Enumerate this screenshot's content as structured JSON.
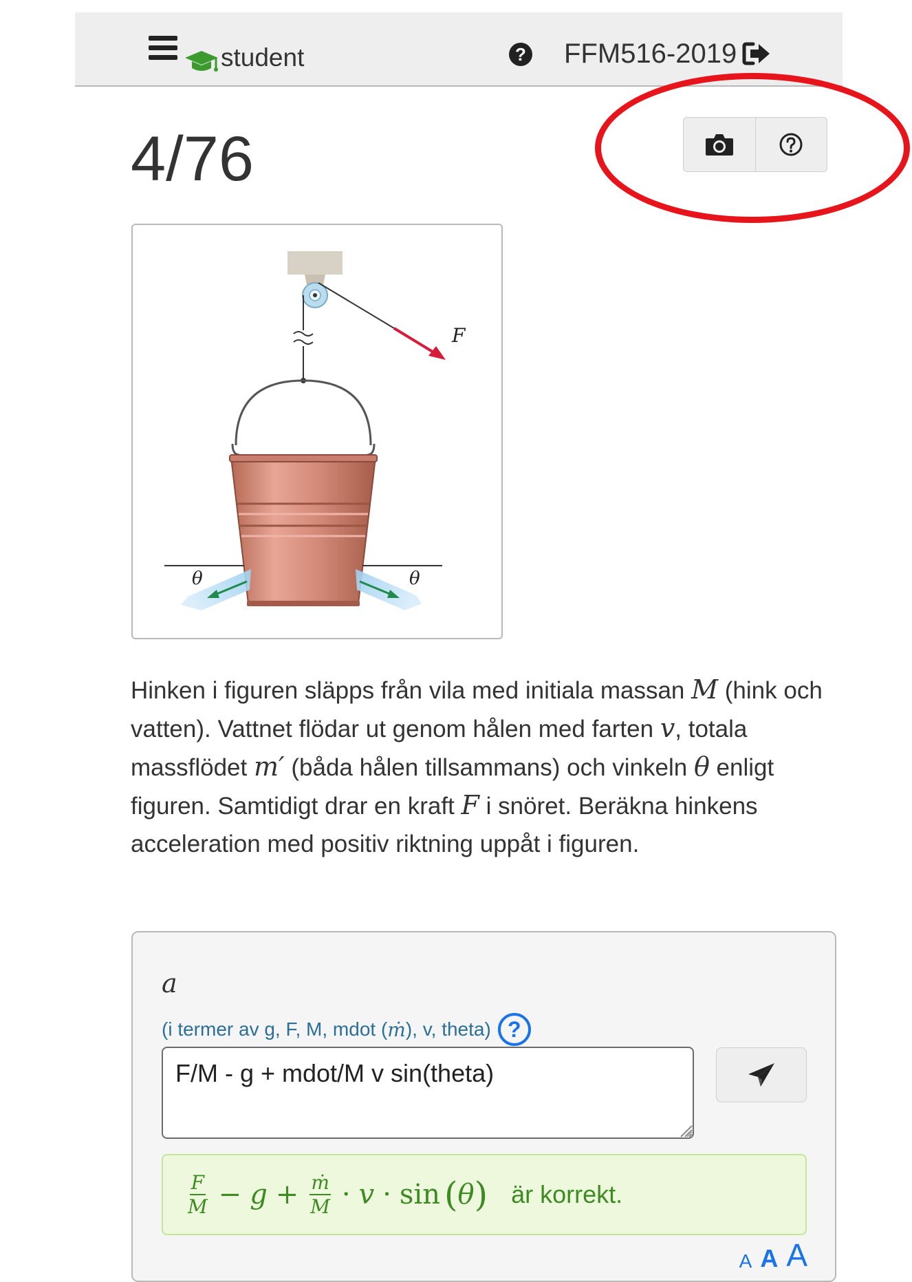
{
  "navbar": {
    "brand_label": "student",
    "help_glyph": "?",
    "course_label": "FFM516-2019",
    "icons": [
      "hamburger-icon",
      "graduation-cap-icon",
      "question-circle-icon",
      "sign-out-icon"
    ]
  },
  "problem": {
    "title": "4/76",
    "toolbar_icons": [
      "camera-icon",
      "question-circle-icon"
    ],
    "figure": {
      "force_label": "F",
      "angle_label_left": "θ",
      "angle_label_right": "θ"
    },
    "text": {
      "p1": "Hinken i figuren släpps från vila med initiala massan ",
      "M": "M",
      "p2": " (hink och vatten). Vattnet flödar ut genom hålen med farten ",
      "v": "v",
      "p3": ", totala massflödet ",
      "m": "m′",
      "p4": " (båda hålen tillsammans) och vinkeln ",
      "theta": "θ",
      "p5": " enligt figuren. Samtidigt drar en kraft ",
      "F": "F",
      "p6": " i snöret. Beräkna hinkens acceleration med positiv riktning uppåt i figuren."
    }
  },
  "answer": {
    "variable": "a",
    "hint_prefix": "(i termer av g, F, M, mdot (",
    "hint_mdot": "ṁ",
    "hint_suffix": "), v, theta)",
    "hint_help_glyph": "?",
    "input_value": "F/M - g + mdot/M v sin(theta)",
    "feedback": {
      "f_num": "F",
      "f_den": "M",
      "minus": "−",
      "g": "g",
      "plus": "+",
      "m_num": "ṁ",
      "m_den": "M",
      "dot1": "·",
      "v": "v",
      "dot2": "·",
      "sin": "sin",
      "lparen": "(",
      "theta": "θ",
      "rparen": ")",
      "result_text": "är korrekt."
    },
    "font_sizes": [
      "A",
      "A",
      "A"
    ]
  },
  "colors": {
    "accent_blue": "#1a73e8",
    "success_green": "#3d8b22",
    "highlight_red": "#e8141b",
    "brand_green": "#3c9a2e"
  }
}
